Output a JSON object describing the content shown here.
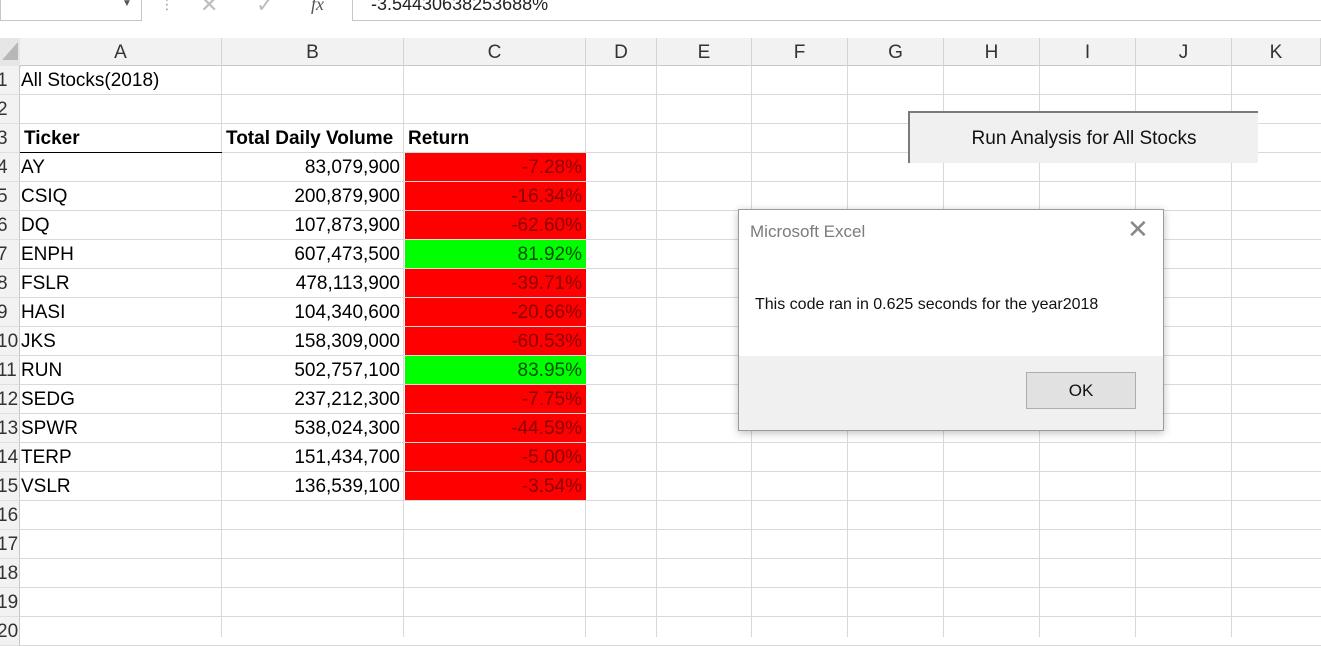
{
  "formula_bar": {
    "formula": "-3.54430638253688%",
    "fx_label": "fx",
    "separator": "⋮",
    "cancel_glyph": "✕",
    "enter_glyph": "✓",
    "dropdown_glyph": "▼"
  },
  "columns": [
    "A",
    "B",
    "C",
    "D",
    "E",
    "F",
    "G",
    "H",
    "I",
    "J",
    "K"
  ],
  "rows": [
    "1",
    "2",
    "3",
    "4",
    "5",
    "6",
    "7",
    "8",
    "9",
    "10",
    "11",
    "12",
    "13",
    "14",
    "15",
    "16",
    "17",
    "18",
    "19",
    "20"
  ],
  "sheet": {
    "title": "All Stocks(2018)",
    "headers": {
      "ticker": "Ticker",
      "volume": "Total Daily Volume",
      "return": "Return"
    },
    "stocks": [
      {
        "ticker": "AY",
        "volume": "83,079,900",
        "return": "-7.28%",
        "status": "negative"
      },
      {
        "ticker": "CSIQ",
        "volume": "200,879,900",
        "return": "-16.34%",
        "status": "negative"
      },
      {
        "ticker": "DQ",
        "volume": "107,873,900",
        "return": "-62.60%",
        "status": "negative"
      },
      {
        "ticker": "ENPH",
        "volume": "607,473,500",
        "return": "81.92%",
        "status": "positive"
      },
      {
        "ticker": "FSLR",
        "volume": "478,113,900",
        "return": "-39.71%",
        "status": "negative"
      },
      {
        "ticker": "HASI",
        "volume": "104,340,600",
        "return": "-20.66%",
        "status": "negative"
      },
      {
        "ticker": "JKS",
        "volume": "158,309,000",
        "return": "-60.53%",
        "status": "negative"
      },
      {
        "ticker": "RUN",
        "volume": "502,757,100",
        "return": "83.95%",
        "status": "positive"
      },
      {
        "ticker": "SEDG",
        "volume": "237,212,300",
        "return": "-7.75%",
        "status": "negative"
      },
      {
        "ticker": "SPWR",
        "volume": "538,024,300",
        "return": "-44.59%",
        "status": "negative"
      },
      {
        "ticker": "TERP",
        "volume": "151,434,700",
        "return": "-5.00%",
        "status": "negative"
      },
      {
        "ticker": "VSLR",
        "volume": "136,539,100",
        "return": "-3.54%",
        "status": "negative"
      }
    ]
  },
  "button": {
    "label": "Run Analysis for All Stocks"
  },
  "dialog": {
    "title": "Microsoft Excel",
    "message": "This code ran in 0.625 seconds for the year2018",
    "ok_label": "OK",
    "close_glyph": "✕"
  },
  "colors": {
    "negative": "#ff0000",
    "positive": "#00ff00"
  }
}
